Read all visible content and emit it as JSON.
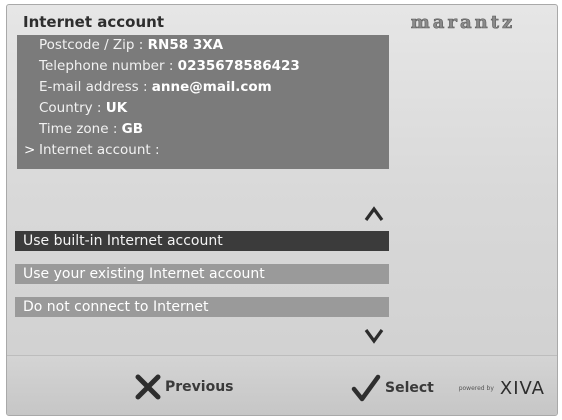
{
  "title": "Internet account",
  "brand": {
    "logo_text": "marantz"
  },
  "info_rows": [
    {
      "label": "Postcode / Zip : ",
      "value": "RN58 3XA"
    },
    {
      "label": "Telephone number : ",
      "value": "0235678586423"
    },
    {
      "label": "E-mail address : ",
      "value": "anne@mail.com"
    },
    {
      "label": "Country : ",
      "value": "UK"
    },
    {
      "label": "Time zone : ",
      "value": "GB"
    },
    {
      "label": "Internet account :",
      "value": ""
    }
  ],
  "cursor_mark": ">",
  "options": [
    {
      "label": "Use built-in Internet account",
      "selected": true
    },
    {
      "label": "Use your existing Internet account",
      "selected": false
    },
    {
      "label": "Do not connect to Internet",
      "selected": false
    }
  ],
  "footer": {
    "previous_label": "Previous",
    "select_label": "Select",
    "powered_by": "powered by",
    "platform": "XIVA"
  },
  "icons": {
    "scroll_up": "chevron-up-icon",
    "scroll_down": "chevron-down-icon",
    "previous": "x-icon",
    "select": "checkmark-icon"
  },
  "colors": {
    "panel": "#7b7b7b",
    "selected_option": "#3b3b3b",
    "option": "#9a9a9a"
  }
}
